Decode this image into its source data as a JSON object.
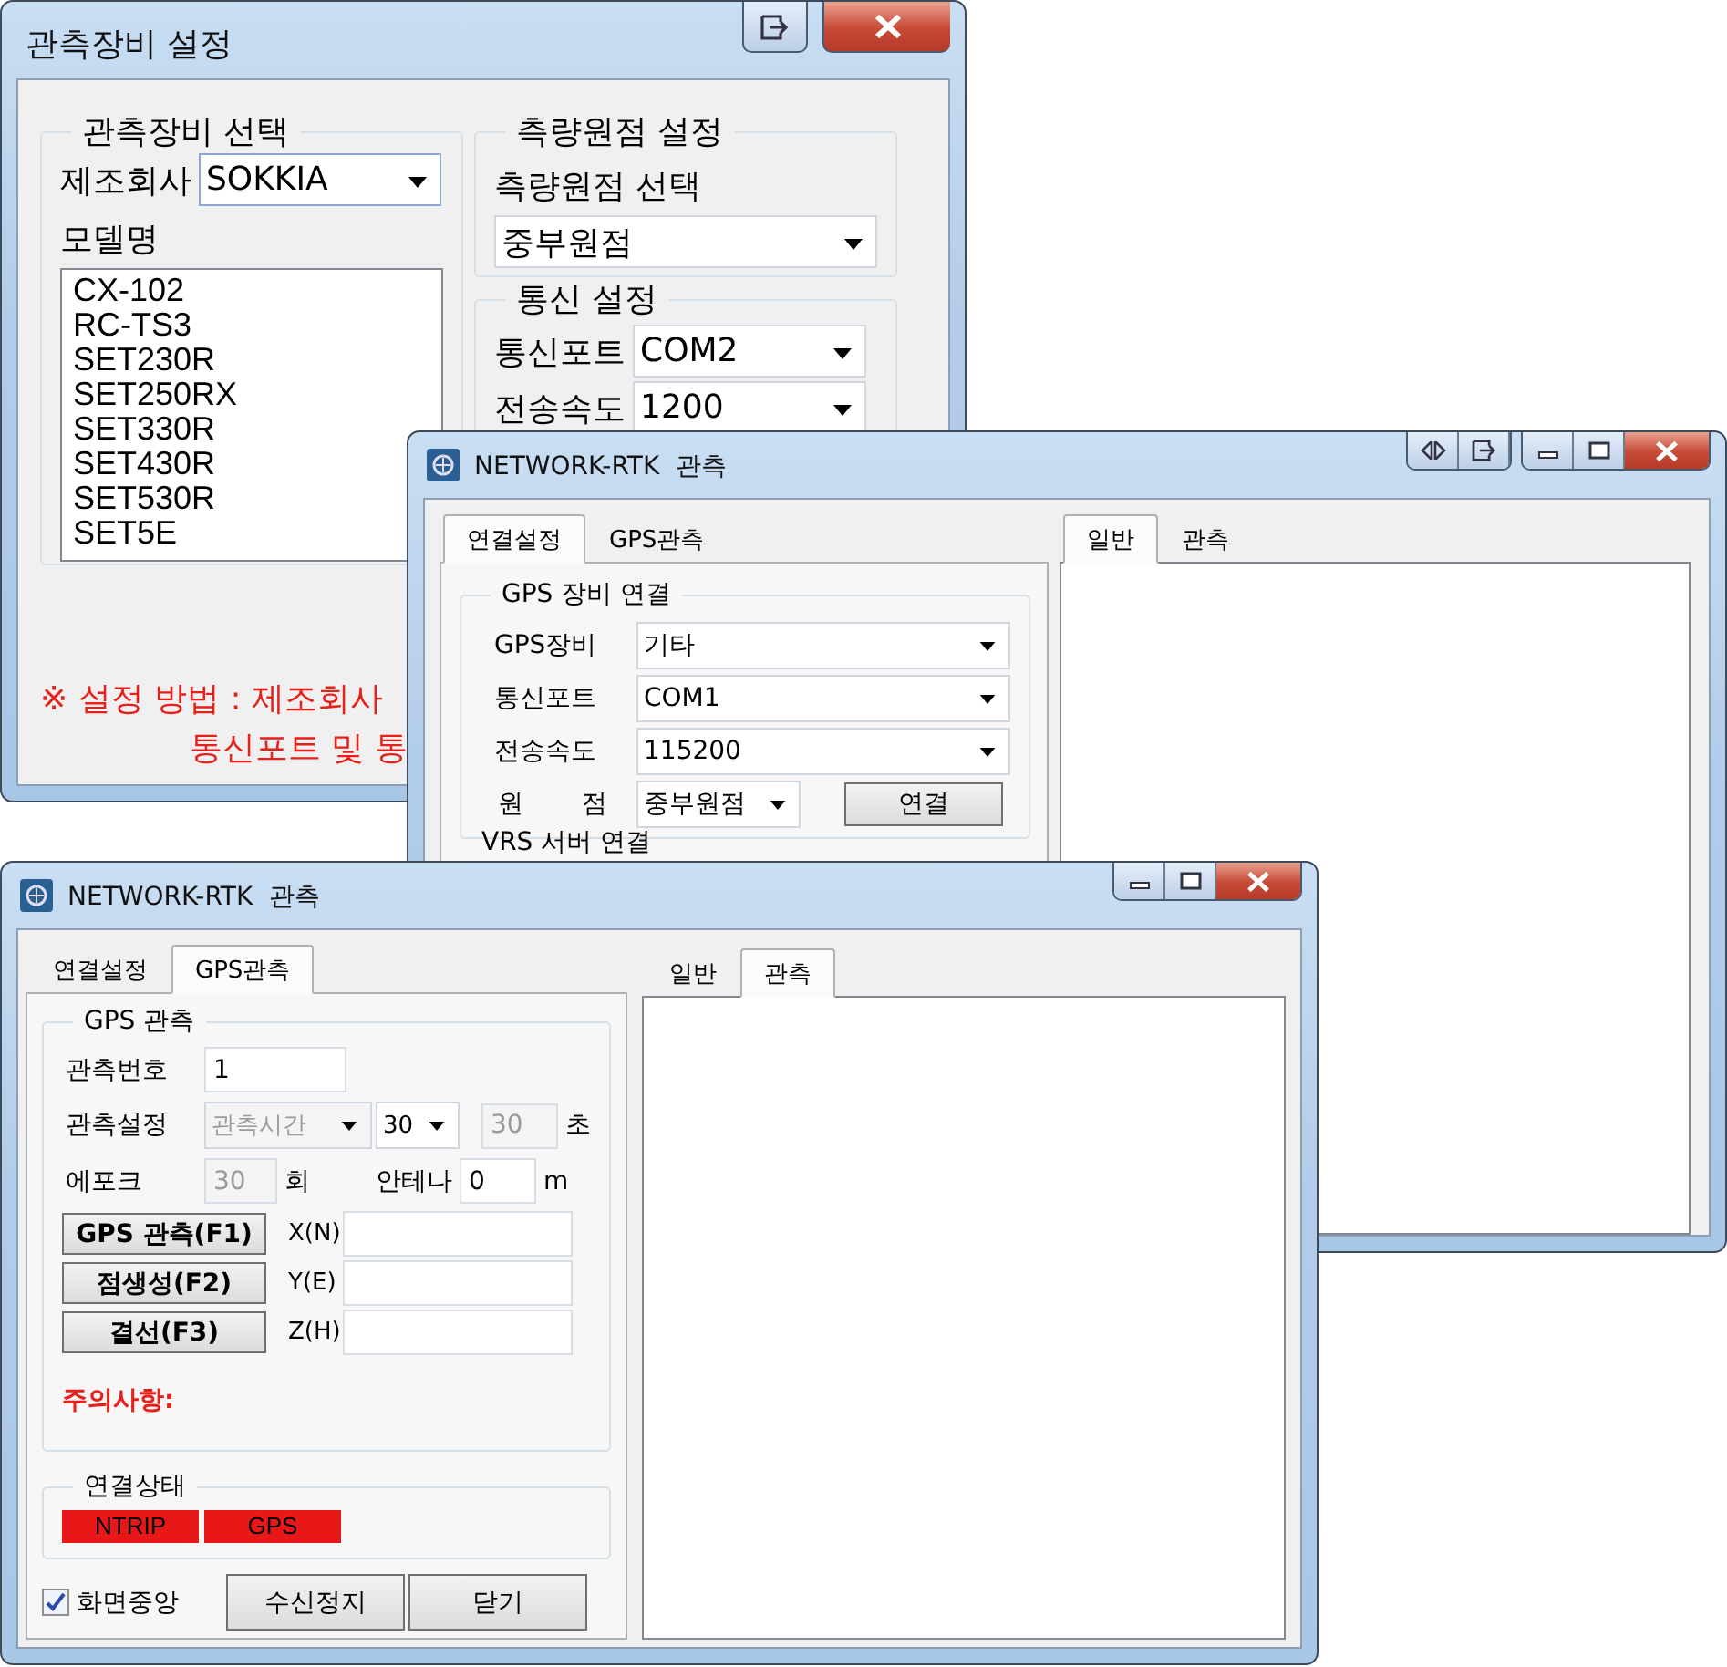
{
  "device_window": {
    "title": "관측장비 설정",
    "device_group": {
      "legend": "관측장비 선택",
      "maker_label": "제조회사",
      "maker_value": "SOKKIA",
      "model_label": "모델명",
      "models": [
        "CX-102",
        "RC-TS3",
        "SET230R",
        "SET250RX",
        "SET330R",
        "SET430R",
        "SET530R",
        "SET5E"
      ]
    },
    "origin_group": {
      "legend": "측량원점 설정",
      "select_label": "측량원점 선택",
      "select_value": "중부원점"
    },
    "comm_group": {
      "legend": "통신 설정",
      "fields": [
        {
          "label": "통신포트",
          "value": "COM2"
        },
        {
          "label": "전송속도",
          "value": "1200"
        }
      ]
    },
    "note_lines": [
      "※ 설정 방법 : 제조회사",
      "통신포트 및 통"
    ]
  },
  "connection_window": {
    "title": "NETWORK-RTK  관측",
    "left_tabs": [
      {
        "label": "연결설정",
        "selected": true
      },
      {
        "label": "GPS관측",
        "selected": false
      }
    ],
    "gps_group": {
      "legend": "GPS 장비 연결",
      "fields": [
        {
          "label": "GPS장비",
          "value": "기타"
        },
        {
          "label": "통신포트",
          "value": "COM1"
        },
        {
          "label": "전송속도",
          "value": "115200"
        }
      ],
      "origin_label": "원 점",
      "origin_value": "중부원점",
      "connect_button": "연결"
    },
    "vrs_legend": "VRS 서버 연결",
    "right_tabs": [
      {
        "label": "일반",
        "selected": true
      },
      {
        "label": "관측",
        "selected": false
      }
    ]
  },
  "observation_window": {
    "title": "NETWORK-RTK  관측",
    "left_tabs": [
      {
        "label": "연결설정",
        "selected": false
      },
      {
        "label": "GPS관측",
        "selected": true
      }
    ],
    "obs_group": {
      "legend": "GPS 관측",
      "number": {
        "label": "관측번호",
        "value": "1",
        "disabled": false
      },
      "setting": {
        "label": "관측설정",
        "mode": {
          "value": "관측시간",
          "disabled": true
        },
        "interval": {
          "value": "30",
          "disabled": false
        },
        "seconds": {
          "value": "30",
          "disabled": true
        },
        "unit": "초"
      },
      "epoch": {
        "label": "에포크",
        "value": "30",
        "disabled": true,
        "unit": "회"
      },
      "antenna": {
        "label": "안테나",
        "value": "0",
        "disabled": false,
        "unit": "m"
      },
      "actions": [
        {
          "button": "GPS 관측(F1)",
          "coord_label": "X(N)"
        },
        {
          "button": "점생성(F2)",
          "coord_label": "Y(E)"
        },
        {
          "button": "결선(F3)",
          "coord_label": "Z(H)"
        }
      ],
      "note": "주의사항:"
    },
    "status_group": {
      "legend": "연결상태",
      "indicators": [
        {
          "label": "NTRIP",
          "color": "#e81818"
        },
        {
          "label": "GPS",
          "color": "#e81818"
        }
      ]
    },
    "center_checkbox": {
      "label": "화면중앙",
      "checked": true
    },
    "buttons": [
      "수신정지",
      "닫기"
    ],
    "right_tabs": [
      {
        "label": "일반",
        "selected": false
      },
      {
        "label": "관측",
        "selected": true
      }
    ]
  }
}
